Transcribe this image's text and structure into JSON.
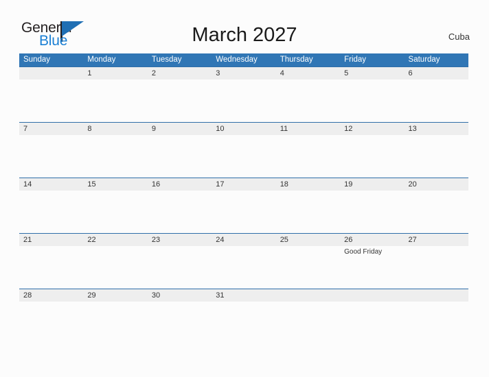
{
  "brand": {
    "name_part1": "General",
    "name_part2": "Blue",
    "triangle_icon": "triangle-icon"
  },
  "header": {
    "title": "March 2027",
    "country": "Cuba"
  },
  "colors": {
    "header_blue": "#3076b5",
    "row_line_blue": "#2e6da8",
    "date_band_gray": "#eeeeee",
    "logo_blue": "#1a7fd4",
    "page_background": "#fcfcfc",
    "text_dark": "#333333"
  },
  "calendar": {
    "month": "March",
    "year": "2027",
    "day_headers": [
      "Sunday",
      "Monday",
      "Tuesday",
      "Wednesday",
      "Thursday",
      "Friday",
      "Saturday"
    ],
    "weeks": [
      {
        "days": [
          {
            "date": "",
            "event": ""
          },
          {
            "date": "1",
            "event": ""
          },
          {
            "date": "2",
            "event": ""
          },
          {
            "date": "3",
            "event": ""
          },
          {
            "date": "4",
            "event": ""
          },
          {
            "date": "5",
            "event": ""
          },
          {
            "date": "6",
            "event": ""
          }
        ]
      },
      {
        "days": [
          {
            "date": "7",
            "event": ""
          },
          {
            "date": "8",
            "event": ""
          },
          {
            "date": "9",
            "event": ""
          },
          {
            "date": "10",
            "event": ""
          },
          {
            "date": "11",
            "event": ""
          },
          {
            "date": "12",
            "event": ""
          },
          {
            "date": "13",
            "event": ""
          }
        ]
      },
      {
        "days": [
          {
            "date": "14",
            "event": ""
          },
          {
            "date": "15",
            "event": ""
          },
          {
            "date": "16",
            "event": ""
          },
          {
            "date": "17",
            "event": ""
          },
          {
            "date": "18",
            "event": ""
          },
          {
            "date": "19",
            "event": ""
          },
          {
            "date": "20",
            "event": ""
          }
        ]
      },
      {
        "days": [
          {
            "date": "21",
            "event": ""
          },
          {
            "date": "22",
            "event": ""
          },
          {
            "date": "23",
            "event": ""
          },
          {
            "date": "24",
            "event": ""
          },
          {
            "date": "25",
            "event": ""
          },
          {
            "date": "26",
            "event": "Good Friday"
          },
          {
            "date": "27",
            "event": ""
          }
        ]
      },
      {
        "days": [
          {
            "date": "28",
            "event": ""
          },
          {
            "date": "29",
            "event": ""
          },
          {
            "date": "30",
            "event": ""
          },
          {
            "date": "31",
            "event": ""
          },
          {
            "date": "",
            "event": ""
          },
          {
            "date": "",
            "event": ""
          },
          {
            "date": "",
            "event": ""
          }
        ]
      }
    ]
  }
}
